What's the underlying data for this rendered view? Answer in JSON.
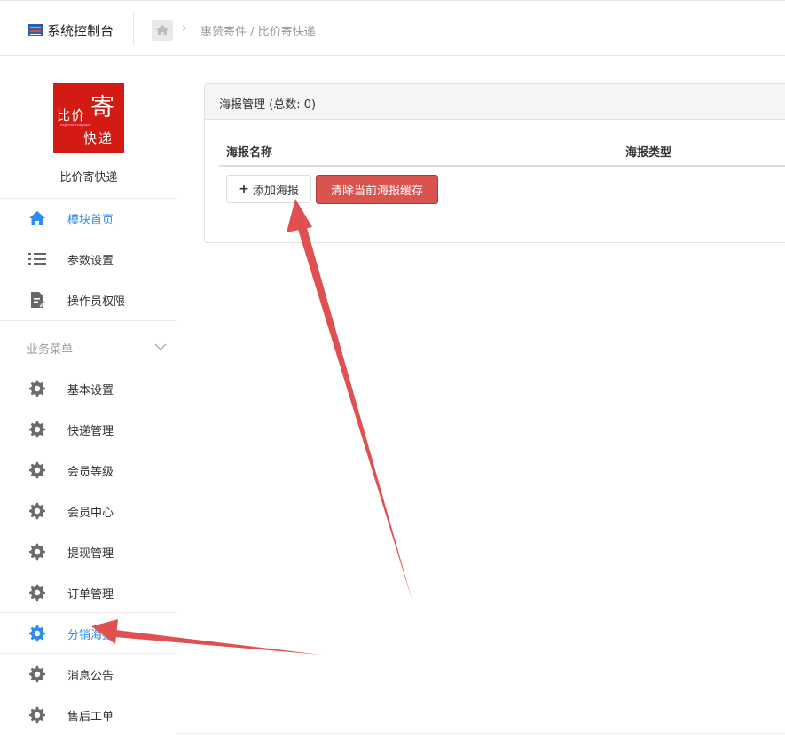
{
  "header": {
    "app_title": "系统控制台",
    "breadcrumb": "惠赞寄件 / 比价寄快递"
  },
  "sidebar": {
    "logo": {
      "line1": "比价",
      "big": "寄",
      "line2": "快递",
      "tagline": "express  compare"
    },
    "shop_name": "比价寄快递",
    "top_items": [
      {
        "label": "模块首页",
        "icon": "home-icon",
        "active": true
      },
      {
        "label": "参数设置",
        "icon": "list-icon",
        "active": false
      },
      {
        "label": "操作员权限",
        "icon": "document-edit-icon",
        "active": false
      }
    ],
    "section_title": "业务菜单",
    "menu_items": [
      {
        "label": "基本设置",
        "icon": "gear-icon",
        "active": false
      },
      {
        "label": "快递管理",
        "icon": "gear-icon",
        "active": false
      },
      {
        "label": "会员等级",
        "icon": "gear-icon",
        "active": false
      },
      {
        "label": "会员中心",
        "icon": "gear-icon",
        "active": false
      },
      {
        "label": "提现管理",
        "icon": "gear-icon",
        "active": false
      },
      {
        "label": "订单管理",
        "icon": "gear-icon",
        "active": false
      },
      {
        "label": "分销海报",
        "icon": "gear-icon",
        "active": true
      },
      {
        "label": "消息公告",
        "icon": "gear-icon",
        "active": false
      },
      {
        "label": "售后工单",
        "icon": "gear-icon",
        "active": false
      }
    ]
  },
  "main": {
    "panel_title": "海报管理 (总数: 0)",
    "columns": [
      "海报名称",
      "海报类型"
    ],
    "add_button": "添加海报",
    "clear_button": "清除当前海报缓存"
  },
  "colors": {
    "accent": "#2d8cf0",
    "danger": "#d9534f",
    "annotation_arrow": "#e05050",
    "logo_bg": "#d31b13"
  }
}
